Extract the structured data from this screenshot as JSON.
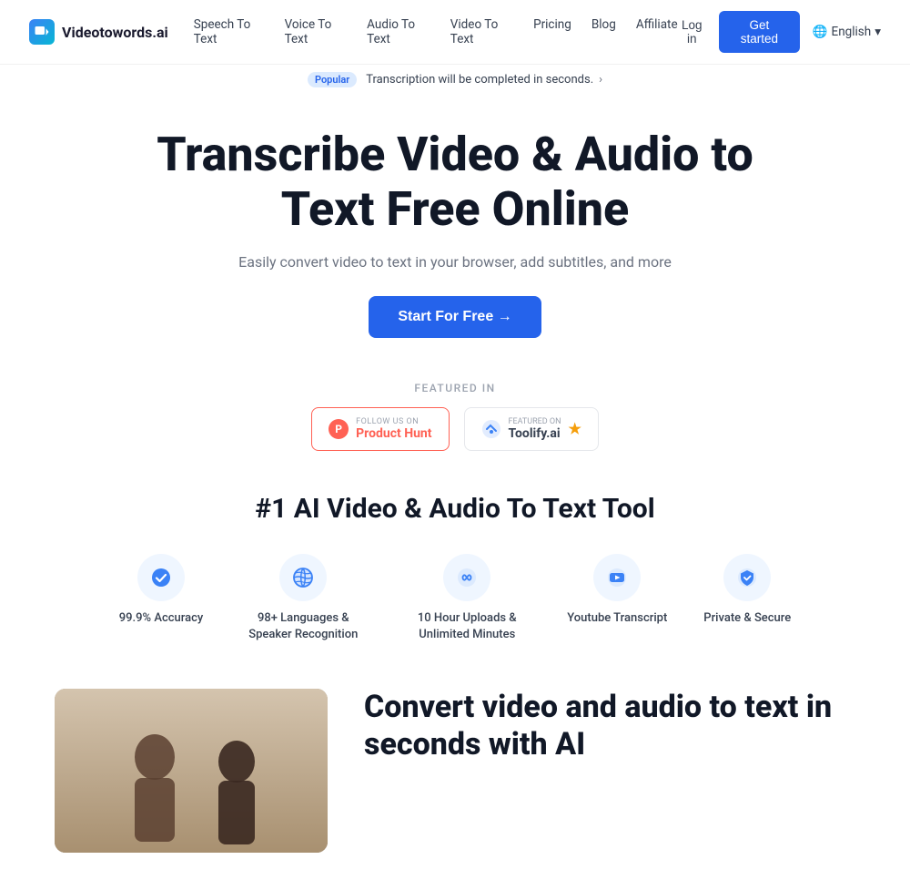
{
  "navbar": {
    "logo_text": "Videotowords.ai",
    "nav_links": [
      {
        "label": "Speech To Text",
        "id": "speech-to-text"
      },
      {
        "label": "Voice To Text",
        "id": "voice-to-text"
      },
      {
        "label": "Audio To Text",
        "id": "audio-to-text"
      },
      {
        "label": "Video To Text",
        "id": "video-to-text"
      },
      {
        "label": "Pricing",
        "id": "pricing"
      },
      {
        "label": "Blog",
        "id": "blog"
      },
      {
        "label": "Affiliate",
        "id": "affiliate"
      }
    ],
    "login_label": "Log in",
    "get_started_label": "Get started",
    "language_label": "English"
  },
  "announcement": {
    "badge_text": "Popular",
    "text": "Transcription will be completed in seconds.",
    "arrow": "›"
  },
  "hero": {
    "title": "Transcribe Video & Audio to Text Free Online",
    "subtitle": "Easily convert video to text in your browser, add subtitles, and more",
    "cta_label": "Start For Free →"
  },
  "featured": {
    "label": "FEATURED IN",
    "producthunt": {
      "follow_text": "FOLLOW US ON",
      "name": "Product Hunt"
    },
    "toolify": {
      "featured_text": "FEATURED ON",
      "name": "Toolify.ai"
    }
  },
  "ai_section": {
    "title": "#1 AI Video & Audio To Text Tool",
    "features": [
      {
        "id": "accuracy",
        "icon": "check-circle",
        "label": "99.9% Accuracy"
      },
      {
        "id": "languages",
        "icon": "globe",
        "label": "98+ Languages & Speaker Recognition"
      },
      {
        "id": "uploads",
        "icon": "infinity",
        "label": "10 Hour Uploads & Unlimited Minutes"
      },
      {
        "id": "youtube",
        "icon": "youtube",
        "label": "Youtube Transcript"
      },
      {
        "id": "secure",
        "icon": "shield",
        "label": "Private & Secure"
      }
    ]
  },
  "convert_section": {
    "title": "Convert video and audio to text in seconds with AI"
  },
  "colors": {
    "accent": "#2563eb",
    "brand_red": "#ff6154",
    "toolify_yellow": "#f59e0b"
  }
}
